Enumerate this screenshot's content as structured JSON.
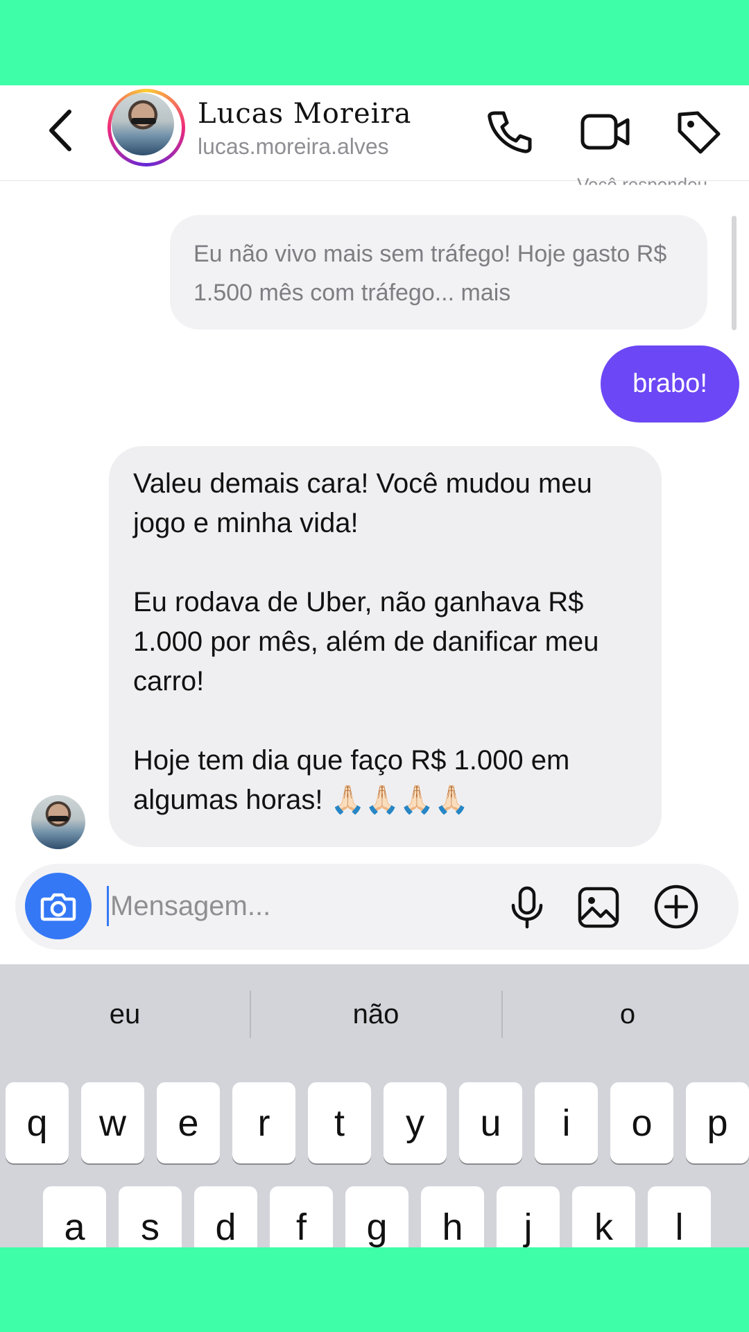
{
  "header": {
    "contact_name": "Lucas Moreira",
    "contact_handle": "lucas.moreira.alves",
    "icons": [
      "back-chevron-icon",
      "phone-icon",
      "video-camera-icon",
      "tag-icon"
    ]
  },
  "messages": {
    "reply_label": "Você respondeu",
    "quoted_text": "Eu não vivo mais sem tráfego! Hoje gasto R$ 1.500 mês com tráfego... mais",
    "sent_text": "brabo!",
    "received_paragraphs": [
      "Valeu demais cara! Você mudou meu jogo e minha vida!",
      "Eu rodava de Uber, não ganhava R$ 1.000 por mês, além de danificar meu carro!",
      "Hoje tem dia que faço R$ 1.000 em algumas horas! 🙏🏻🙏🏻🙏🏻🙏🏻"
    ]
  },
  "composer": {
    "placeholder": "Mensagem...",
    "icons": [
      "camera-icon",
      "microphone-icon",
      "gallery-icon",
      "plus-circle-icon"
    ]
  },
  "keyboard": {
    "suggestions": [
      "eu",
      "não",
      "o"
    ],
    "row1": [
      "q",
      "w",
      "e",
      "r",
      "t",
      "y",
      "u",
      "i",
      "o",
      "p"
    ],
    "row2": [
      "a",
      "s",
      "d",
      "f",
      "g",
      "h",
      "j",
      "k",
      "l"
    ]
  },
  "colors": {
    "background_frame": "#3ffea8",
    "sent_bubble": "#6c47f5",
    "camera_button": "#3478f6",
    "received_bubble": "#efeff1"
  }
}
